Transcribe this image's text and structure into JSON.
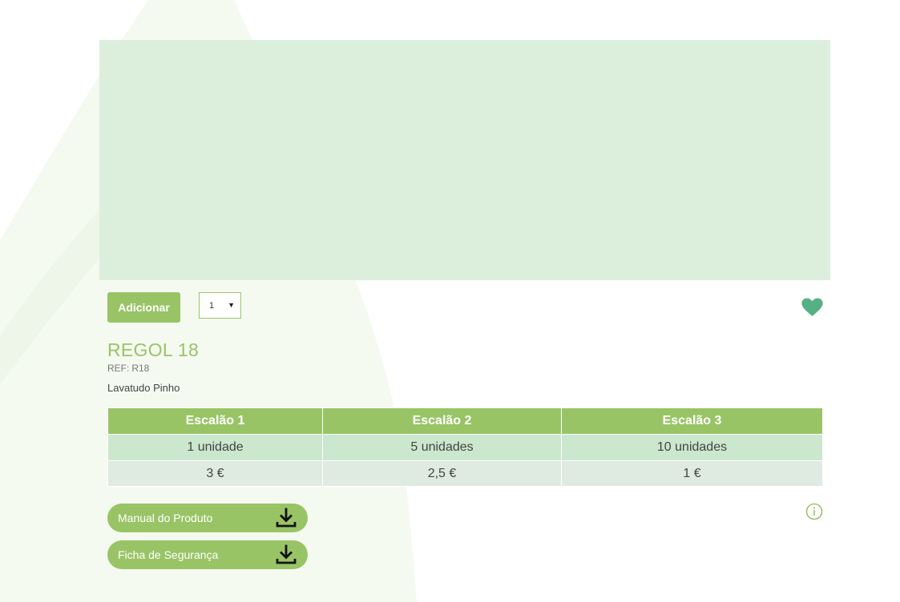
{
  "colors": {
    "accent": "#99c466",
    "heart": "#55b084",
    "image_placeholder": "#dcefdc",
    "row_quantity": "#cbe7cd",
    "row_price": "#dfeae0"
  },
  "actions": {
    "add_label": "Adicionar",
    "quantity_value": "1",
    "favorite_icon": "heart-icon"
  },
  "product": {
    "name": "REGOL 18",
    "ref_label": "REF:",
    "ref_value": "R18",
    "description": "Lavatudo Pinho"
  },
  "pricing": {
    "headers": [
      "Escalão 1",
      "Escalão 2",
      "Escalão 3"
    ],
    "quantities": [
      "1 unidade",
      "5 unidades",
      "10 unidades"
    ],
    "prices": [
      "3 €",
      "2,5 €",
      "1 €"
    ]
  },
  "downloads": [
    {
      "label": "Manual do Produto",
      "icon": "download-icon"
    },
    {
      "label": "Ficha de Segurança",
      "icon": "download-icon"
    }
  ],
  "info_icon": "info-icon"
}
